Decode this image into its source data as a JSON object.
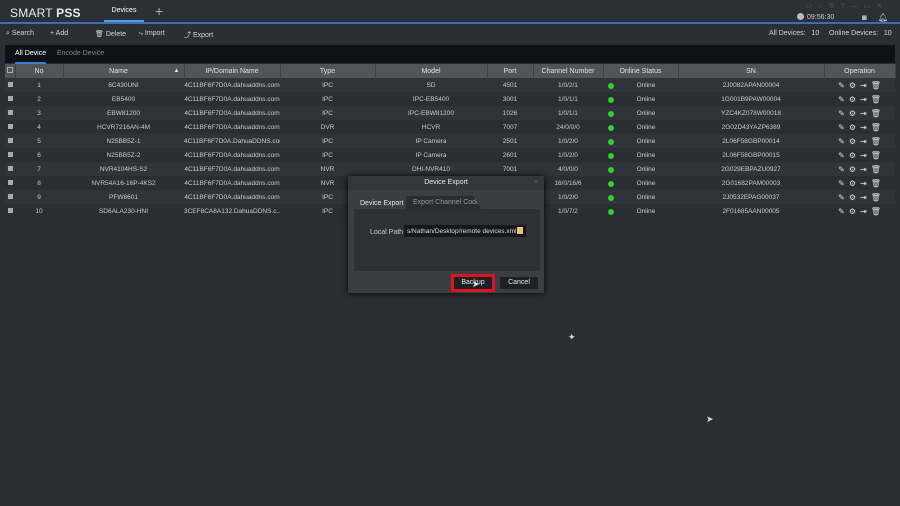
{
  "app": {
    "logo_light": "SMART ",
    "logo_bold": "PSS",
    "tab": "Devices",
    "add_tab": "+",
    "time": "09:56:30"
  },
  "toolbar": {
    "search": "Search",
    "add": "+ Add",
    "delete": "Delete",
    "import": "Import",
    "export": "Export",
    "all_devices_label": "All Devices:",
    "all_devices": "10",
    "online_devices_label": "Online Devices:",
    "online_devices": "10"
  },
  "device_tabs": [
    "All Device",
    "Encode Device"
  ],
  "table": {
    "columns": [
      "No",
      "Name",
      "IP/Domain Name",
      "Type",
      "Model",
      "Port",
      "Channel Number",
      "Online Status",
      "SN",
      "Operation"
    ],
    "status_color": "#2fd02f",
    "rows": [
      [
        "1",
        "6C430UNI",
        "4C11BF6F7D0A.dahuaddns.com",
        "IPC",
        "SD",
        "4501",
        "1/0/2/1",
        "Online",
        "2J0082APAN00004"
      ],
      [
        "2",
        "EB5400",
        "4C11BF6F7D0A.dahuaddns.com",
        "IPC",
        "IPC-EB5400",
        "3001",
        "1/0/1/1",
        "Online",
        "1G001B9PAW00004"
      ],
      [
        "3",
        "EBW81200",
        "4C11BF6F7D0A.dahuaddns.com",
        "IPC",
        "IPC-EBW81200",
        "1026",
        "1/0/1/1",
        "Online",
        "YZC4KZ078W00018"
      ],
      [
        "4",
        "HCVR7216AN-4M",
        "4C11BF6F7D0A.dahuaddns.com",
        "DVR",
        "HCVR",
        "7007",
        "24/0/0/0",
        "Online",
        "2G02D43YAZP6389"
      ],
      [
        "5",
        "N25BB5Z-1",
        "4C11BF6F7D0A.DahuaDDNS.com",
        "IPC",
        "IP Camera",
        "2501",
        "1/0/2/0",
        "Online",
        "2L06F58GBP00014"
      ],
      [
        "6",
        "N25BB5Z-2",
        "4C11BF6F7D0A.dahuaddns.com",
        "IPC",
        "IP Camera",
        "2601",
        "1/0/2/0",
        "Online",
        "2L06F58GBP00015"
      ],
      [
        "7",
        "NVR4104HS-S2",
        "4C11BF6F7D0A.dahuaddns.com",
        "NVR",
        "DHI-NVR410",
        "7001",
        "4/0/0/0",
        "Online",
        "2G029EBPAZU0927"
      ],
      [
        "8",
        "NVR54A16-16P-4KS2",
        "4C11BF6F7D0A.dahuaddns.com",
        "NVR",
        "",
        "",
        "16/0/16/6",
        "Online",
        "2G01682PAM00003"
      ],
      [
        "9",
        "PFW8601",
        "4C11BF6F7D0A.dahuaddns.com",
        "IPC",
        "",
        "",
        "1/0/2/0",
        "Online",
        "2J0532EPAG00037"
      ],
      [
        "10",
        "SD6ALA230-HNI",
        "3CEF8CA8A132.DahuaDDNS.c...",
        "IPC",
        "",
        "",
        "1/0/7/2",
        "Online",
        "2F01685AAN00005"
      ]
    ]
  },
  "dialog": {
    "title": "Device Export",
    "tab_active": "Device Export",
    "tab_inactive": "Export Channel Code",
    "local_path_label": "Local Path",
    "local_path": "s/Nathan/Desktop/remote devices.xml",
    "backup": "Backup",
    "cancel": "Cancel",
    "close": "×"
  }
}
